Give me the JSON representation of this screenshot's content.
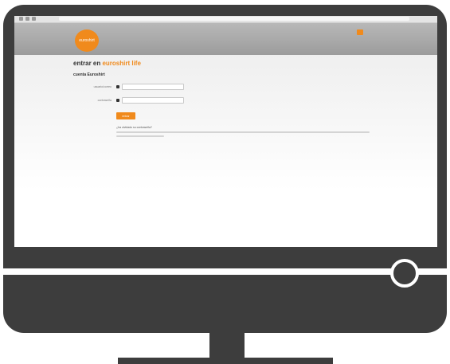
{
  "page": {
    "title_prefix": "entrar en",
    "title_brand": "euroshirt life",
    "subtitle": "cuenta Euroshirt",
    "logo_text": "euroshirt"
  },
  "form": {
    "username_label": "usuario/correo",
    "password_label": "contraseña",
    "login_button": "entrar"
  },
  "help": {
    "heading": "¿ha olvidado su contraseña?"
  },
  "colors": {
    "accent": "#f08a1c",
    "monitor": "#3d3d3d",
    "header_gray": "#a8a8a8"
  },
  "icons": [
    "user-icon",
    "lock-icon",
    "flag-icon",
    "back-icon",
    "forward-icon",
    "reload-icon"
  ]
}
